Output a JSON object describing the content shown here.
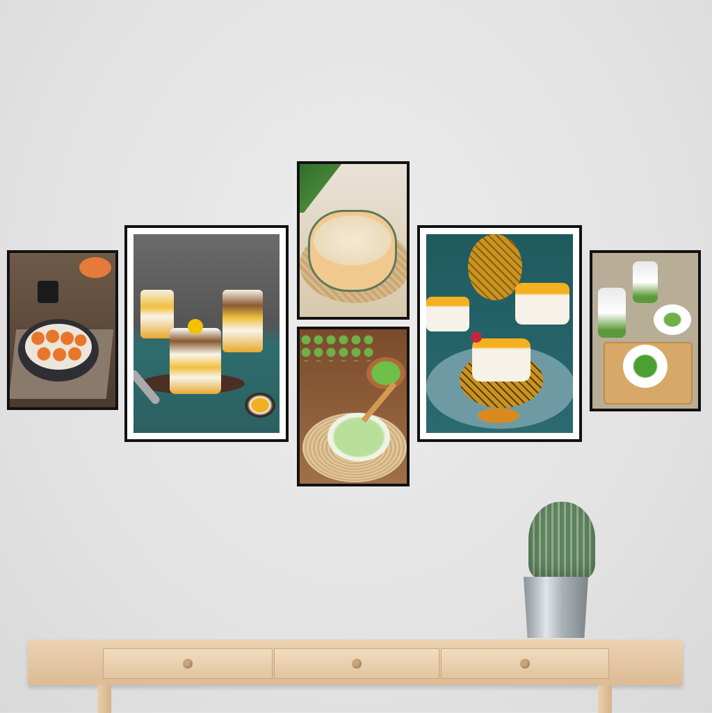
{
  "colors": {
    "wall": "#e6e6e6",
    "frame": "#111111",
    "mat": "#ffffff",
    "wood": "#e2c49f",
    "pot": "#b8c0c6",
    "cactus": "#6f8f6a"
  },
  "artworks": [
    {
      "subject": "pumpkin-balls-dessert"
    },
    {
      "subject": "mango-coconut-jars"
    },
    {
      "subject": "coconut-pudding-bowl"
    },
    {
      "subject": "green-jelly-dessert"
    },
    {
      "subject": "pineapple-panna-cotta"
    },
    {
      "subject": "green-dessert-jars"
    }
  ]
}
